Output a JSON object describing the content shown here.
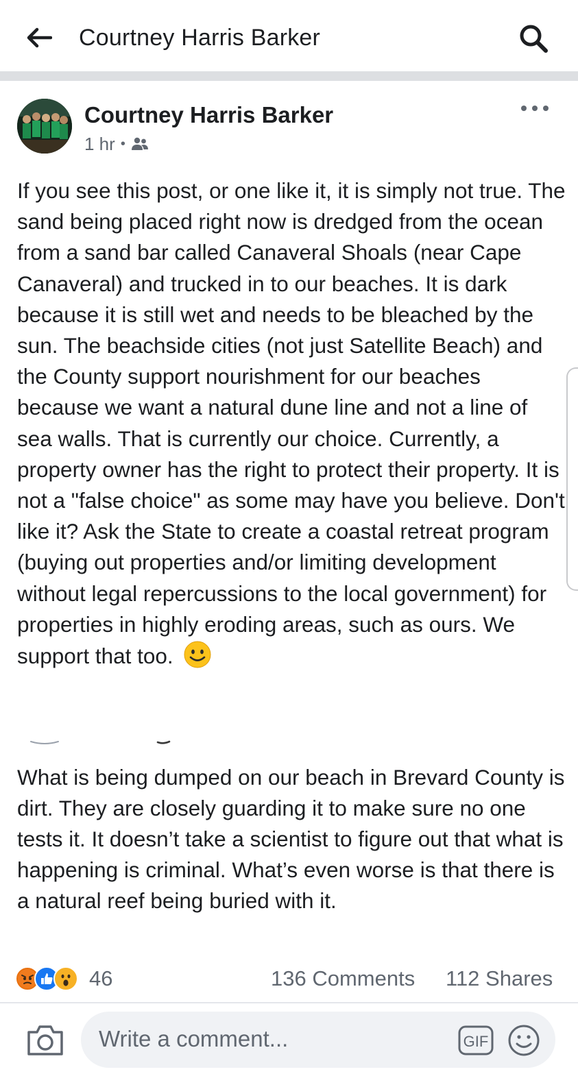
{
  "topbar": {
    "title": "Courtney Harris Barker",
    "back_icon": "arrow-left-icon",
    "search_icon": "search-icon"
  },
  "post": {
    "author": "Courtney Harris Barker",
    "time": "1 hr",
    "audience_icon": "friends-icon",
    "more_icon": "more-dots-icon",
    "body": "If you see this post, or one like it, it is simply not true.  The sand being placed right now is dredged from the ocean from a sand bar called Canaveral Shoals (near Cape Canaveral) and trucked in to our beaches.  It is dark because it is still wet and needs to be bleached by the sun. The beachside cities (not just Satellite Beach) and the County support nourishment for our beaches because we want a natural dune line and not a line of sea walls.  That is currently our choice.  Currently, a property owner has the right to protect their property.  It is not a \"false choice\" as some may have you believe.  Don't like it? Ask the State to create a coastal retreat program (buying out properties and/or limiting development without legal repercussions to the local government) for properties in highly eroding areas, such as ours.  We support that too.",
    "emoji_icon": "smiling-face-emoji",
    "shared_text": "What is being dumped on our beach in Brevard County is dirt. They are closely guarding it to make sure no one tests it. It doesn’t take a scientist to figure out that what is happening is criminal. What’s even worse is that there is a natural reef being buried with it."
  },
  "stats": {
    "reactions": [
      "angry",
      "like",
      "wow"
    ],
    "reaction_count": "46",
    "comments": "136 Comments",
    "shares": "112 Shares"
  },
  "composer": {
    "camera_icon": "camera-icon",
    "placeholder": "Write a comment...",
    "gif_label": "GIF",
    "emoji_icon": "smiley-icon"
  },
  "colors": {
    "text": "#1c1e21",
    "secondary": "#606770",
    "like_blue": "#1877f2",
    "angry": "#e9710f",
    "wow": "#f7b125",
    "input_bg": "#f0f2f5"
  }
}
